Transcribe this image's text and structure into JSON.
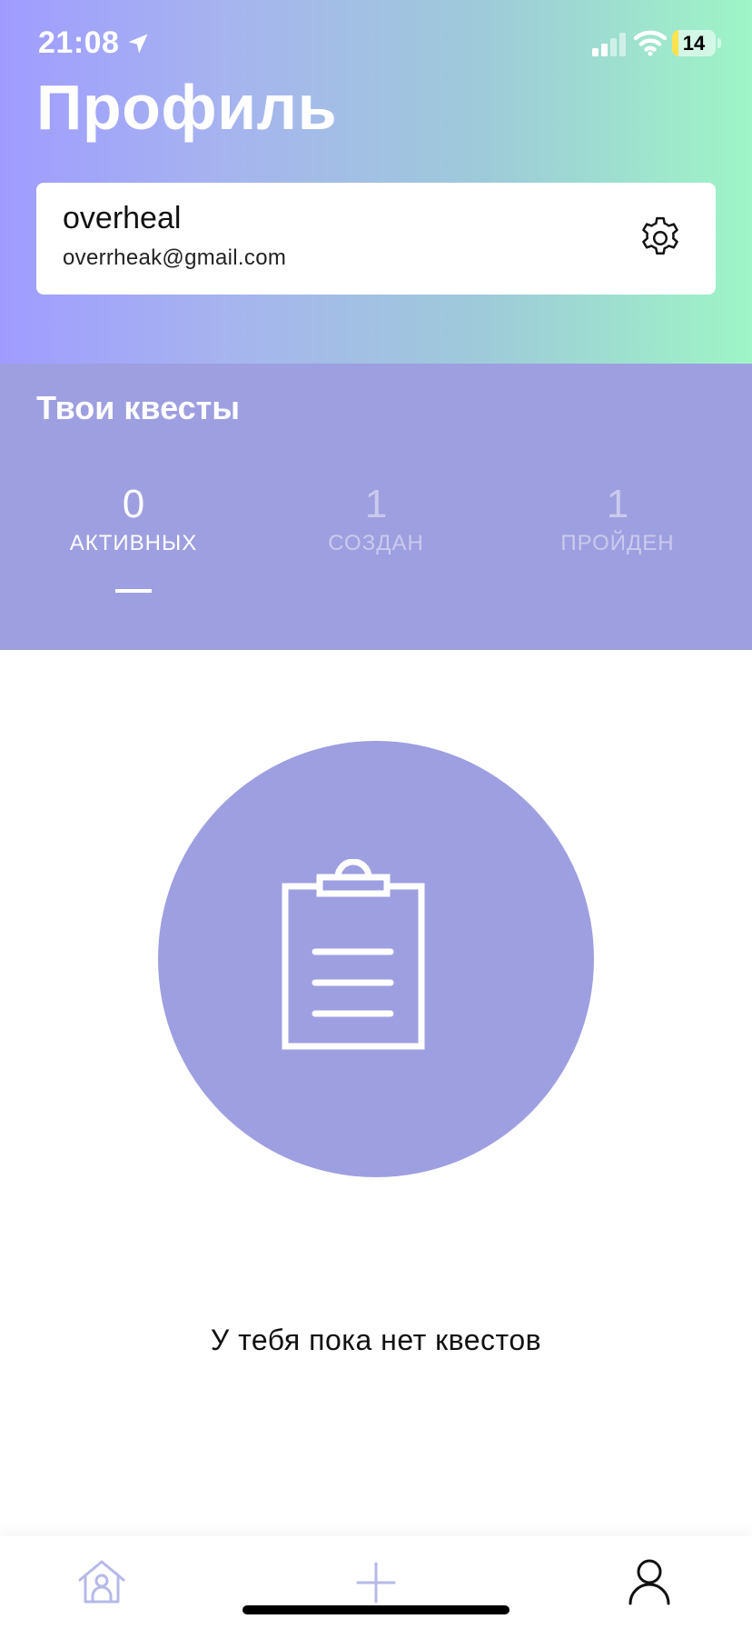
{
  "status_bar": {
    "time": "21:08",
    "battery": "14",
    "battery_level": 0.14,
    "icons": [
      "location-arrow-icon",
      "cellular-signal-icon",
      "wifi-icon",
      "battery-icon"
    ]
  },
  "header": {
    "title": "Профиль"
  },
  "profile": {
    "username": "overheal",
    "email": "overrheak@gmail.com",
    "settings_icon": "gear-icon"
  },
  "quests": {
    "title": "Твои квесты",
    "tabs": [
      {
        "count": "0",
        "label": "АКТИВНЫХ",
        "active": true
      },
      {
        "count": "1",
        "label": "СОЗДАН",
        "active": false
      },
      {
        "count": "1",
        "label": "ПРОЙДЕН",
        "active": false
      }
    ]
  },
  "empty_state": {
    "icon": "clipboard-icon",
    "message": "У тебя пока нет квестов"
  },
  "tab_bar": {
    "items": [
      {
        "icon": "home-icon",
        "active": false
      },
      {
        "icon": "plus-icon",
        "active": false
      },
      {
        "icon": "user-icon",
        "active": true
      }
    ]
  },
  "colors": {
    "gradient_start": "#a09cff",
    "gradient_end": "#9ef5c6",
    "accent_purple": "#9e9fe0",
    "battery_yellow": "#ffe24d",
    "inactive_icon": "#b7b9e8"
  }
}
